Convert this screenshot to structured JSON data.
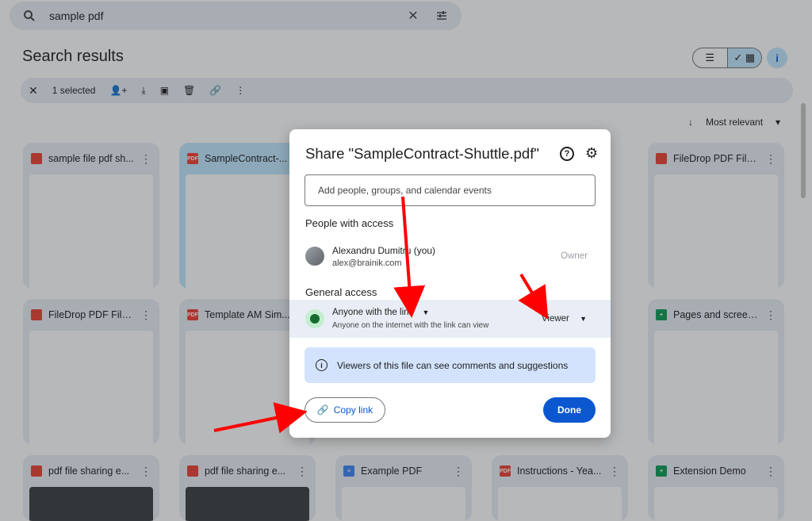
{
  "search": {
    "query": "sample pdf"
  },
  "page": {
    "title": "Search results"
  },
  "selection_bar": {
    "count_label": "1 selected"
  },
  "sort": {
    "label": "Most relevant"
  },
  "files": [
    {
      "name": "sample file pdf sh...",
      "type": "image"
    },
    {
      "name": "SampleContract-...",
      "type": "pdf"
    },
    {
      "name": "FileDrop PDF File ...",
      "type": "image"
    },
    {
      "name": "FileDrop PDF File ...",
      "type": "image"
    },
    {
      "name": "Template AM Sim...",
      "type": "pdf"
    },
    {
      "name": "Pages and screen...",
      "type": "sheet"
    },
    {
      "name": "pdf file sharing e...",
      "type": "image"
    },
    {
      "name": "pdf file sharing e...",
      "type": "image"
    },
    {
      "name": "Example PDF",
      "type": "doc"
    },
    {
      "name": "Instructions - Yea...",
      "type": "pdf"
    },
    {
      "name": "Extension Demo",
      "type": "sheet"
    }
  ],
  "dialog": {
    "title": "Share \"SampleContract-Shuttle.pdf\"",
    "add_placeholder": "Add people, groups, and calendar events",
    "people_heading": "People with access",
    "person": {
      "name": "Alexandru Dumitru (you)",
      "email": "alex@brainik.com",
      "role": "Owner"
    },
    "general_heading": "General access",
    "general_access": {
      "scope": "Anyone with the link",
      "description": "Anyone on the internet with the link can view",
      "role": "Viewer"
    },
    "info_text": "Viewers of this file can see comments and suggestions",
    "copy_label": "Copy link",
    "done_label": "Done"
  },
  "colors": {
    "accent": "#0b57d0",
    "annotation_arrow": "#ff0000"
  }
}
